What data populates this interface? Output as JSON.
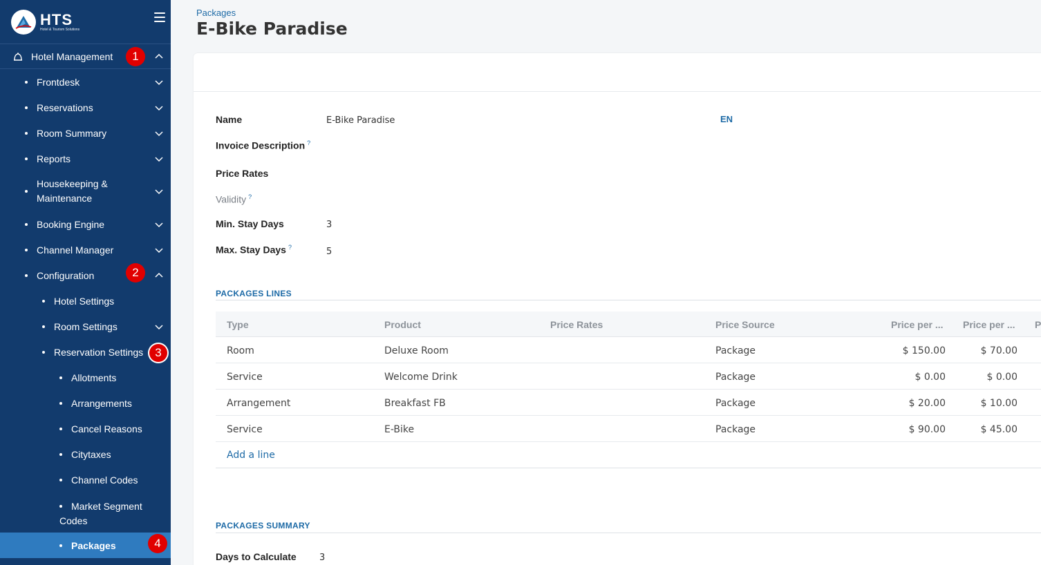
{
  "sidebar": {
    "brand": {
      "name": "HTS",
      "sub": "Hotel & Tourism Solutions"
    },
    "items": [
      {
        "label": "Hotel Management"
      },
      {
        "label": "Frontdesk"
      },
      {
        "label": "Reservations"
      },
      {
        "label": "Room Summary"
      },
      {
        "label": "Reports"
      },
      {
        "label": "Housekeeping &",
        "label2": "Maintenance"
      },
      {
        "label": "Booking Engine"
      },
      {
        "label": "Channel Manager"
      },
      {
        "label": "Configuration"
      },
      {
        "label": "Hotel Settings"
      },
      {
        "label": "Room Settings"
      },
      {
        "label": "Reservation Settings"
      },
      {
        "label": "Allotments"
      },
      {
        "label": "Arrangements"
      },
      {
        "label": "Cancel Reasons"
      },
      {
        "label": "Citytaxes"
      },
      {
        "label": "Channel Codes"
      },
      {
        "label": "Market Segment",
        "label2": "Codes"
      },
      {
        "label": "Packages"
      }
    ],
    "badges": [
      "1",
      "2",
      "3",
      "4"
    ]
  },
  "header": {
    "breadcrumb": "Packages",
    "title": "E-Bike Paradise"
  },
  "form": {
    "name_label": "Name",
    "name_value": "E-Bike Paradise",
    "lang": "EN",
    "invoice_label": "Invoice Description",
    "price_rates_label": "Price Rates",
    "validity_label": "Validity",
    "min_stay_label": "Min. Stay Days",
    "min_stay_value": "3",
    "max_stay_label": "Max. Stay Days",
    "max_stay_value": "5",
    "help_mark": "?"
  },
  "lines": {
    "section_title": "PACKAGES LINES",
    "columns": [
      "Type",
      "Product",
      "Price Rates",
      "Price Source",
      "Price per ...",
      "Price per ...",
      "P"
    ],
    "rows": [
      {
        "type": "Room",
        "product": "Deluxe Room",
        "rates": "",
        "source": "Package",
        "p1": "$ 150.00",
        "p2": "$ 70.00"
      },
      {
        "type": "Service",
        "product": "Welcome Drink",
        "rates": "",
        "source": "Package",
        "p1": "$ 0.00",
        "p2": "$ 0.00"
      },
      {
        "type": "Arrangement",
        "product": "Breakfast FB",
        "rates": "",
        "source": "Package",
        "p1": "$ 20.00",
        "p2": "$ 10.00"
      },
      {
        "type": "Service",
        "product": "E-Bike",
        "rates": "",
        "source": "Package",
        "p1": "$ 90.00",
        "p2": "$ 45.00"
      }
    ],
    "add_line": "Add a line"
  },
  "summary": {
    "section_title": "PACKAGES SUMMARY",
    "days_label": "Days to Calculate",
    "days_value": "3"
  },
  "colors": {
    "sidebar_bg": "#123b6d",
    "active_item": "#2f7bbf",
    "accent": "#1d6aa6",
    "badge": "#e10000"
  }
}
